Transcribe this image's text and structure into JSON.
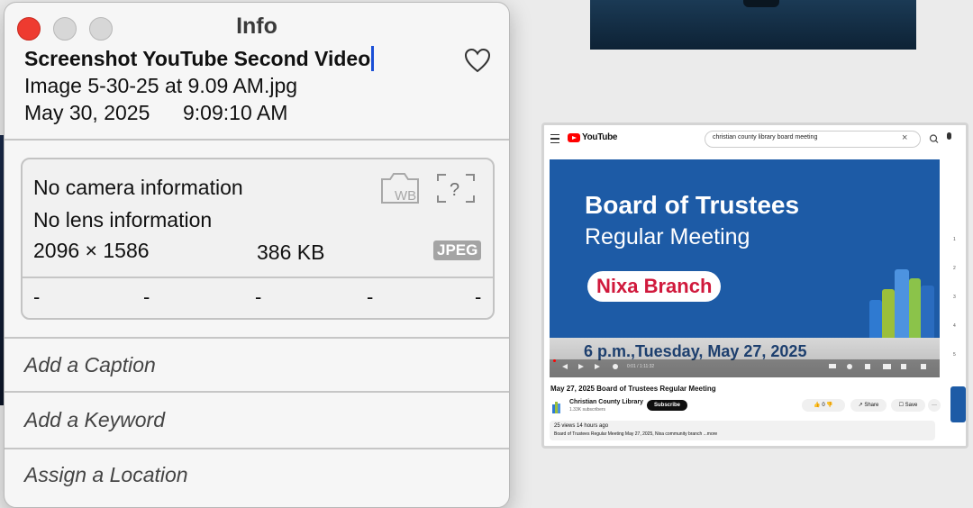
{
  "info_window": {
    "title": "Info",
    "file_name_line1": "Screenshot YouTube Second Video",
    "file_name_line2": "Image 5-30-25 at 9.09 AM.jpg",
    "date": "May 30, 2025",
    "time": "9:09:10 AM",
    "meta": {
      "camera": "No camera information",
      "lens": "No lens information",
      "dimensions": "2096 × 1586",
      "size": "386 KB",
      "format_badge": "JPEG",
      "exif_values": [
        "-",
        "-",
        "-",
        "-",
        "-"
      ],
      "camera_icon_text": "WB",
      "help_icon_text": "?"
    },
    "fields": {
      "caption_placeholder": "Add a Caption",
      "keyword_placeholder": "Add a Keyword",
      "location_placeholder": "Assign a Location"
    }
  },
  "youtube_preview": {
    "logo_text": "YouTube",
    "search_query": "christian county library board meeting",
    "video": {
      "line1": "Board of Trustees",
      "line2": "Regular Meeting",
      "branch": "Nixa Branch",
      "datetime": "6 p.m.,Tuesday, May 27, 2025",
      "progress_time": "0:01 / 1:11:32"
    },
    "title": "May 27, 2025 Board of Trustees Regular Meeting",
    "channel": "Christian County Library",
    "subscribers": "1.33K subscribers",
    "subscribe_label": "Subscribe",
    "like_count": "0",
    "share_label": "Share",
    "save_label": "Save",
    "more_label": "···",
    "views": "25 views  14 hours ago",
    "description": "Board of Trustees Regular Meeting May 27, 2025, Nixa community branch ...more",
    "rail_numbers": [
      "1",
      "2",
      "3",
      "4",
      "5"
    ]
  },
  "colors": {
    "close_button": "#ee3b30",
    "video_blue": "#1d5ba6",
    "branch_red": "#d0193c",
    "text_cursor": "#1a4fd6"
  }
}
